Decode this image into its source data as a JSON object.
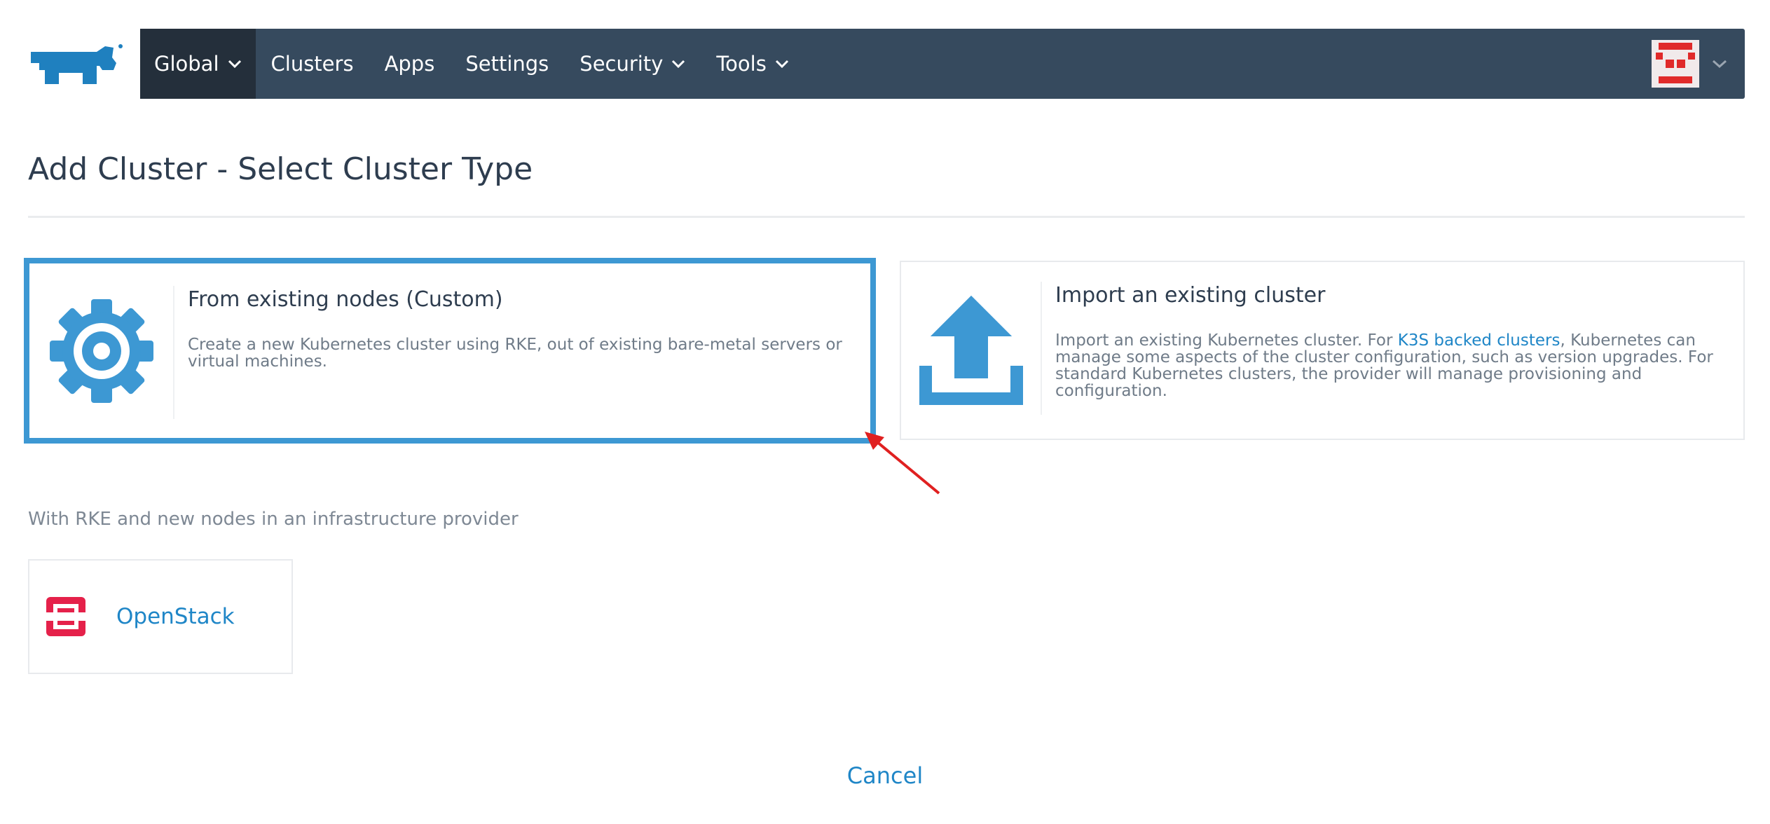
{
  "nav": {
    "global_label": "Global",
    "items": [
      {
        "label": "Clusters",
        "has_dropdown": false
      },
      {
        "label": "Apps",
        "has_dropdown": false
      },
      {
        "label": "Settings",
        "has_dropdown": false
      },
      {
        "label": "Security",
        "has_dropdown": true
      },
      {
        "label": "Tools",
        "has_dropdown": true
      }
    ]
  },
  "page": {
    "title": "Add Cluster - Select Cluster Type"
  },
  "cards": {
    "custom": {
      "title": "From existing nodes (Custom)",
      "description": "Create a new Kubernetes cluster using RKE, out of existing bare-metal servers or virtual machines.",
      "icon": "gear-icon",
      "selected": true
    },
    "import": {
      "title": "Import an existing cluster",
      "description_before": "Import an existing Kubernetes cluster. For ",
      "link_text": "K3S backed clusters",
      "description_after": ", Kubernetes can manage some aspects of the cluster configuration, such as version upgrades. For standard Kubernetes clusters, the provider will manage provisioning and configuration.",
      "icon": "upload-icon"
    }
  },
  "infra": {
    "section_label": "With RKE and new nodes in an infrastructure provider",
    "providers": [
      {
        "name": "OpenStack",
        "icon": "openstack-icon"
      }
    ]
  },
  "actions": {
    "cancel_label": "Cancel"
  },
  "colors": {
    "navbar": "#364a5e",
    "nav_active": "#242f3b",
    "accent": "#3d98d3",
    "link": "#1f86c7",
    "openstack": "#e5214a",
    "annotation_arrow": "#e02020"
  }
}
